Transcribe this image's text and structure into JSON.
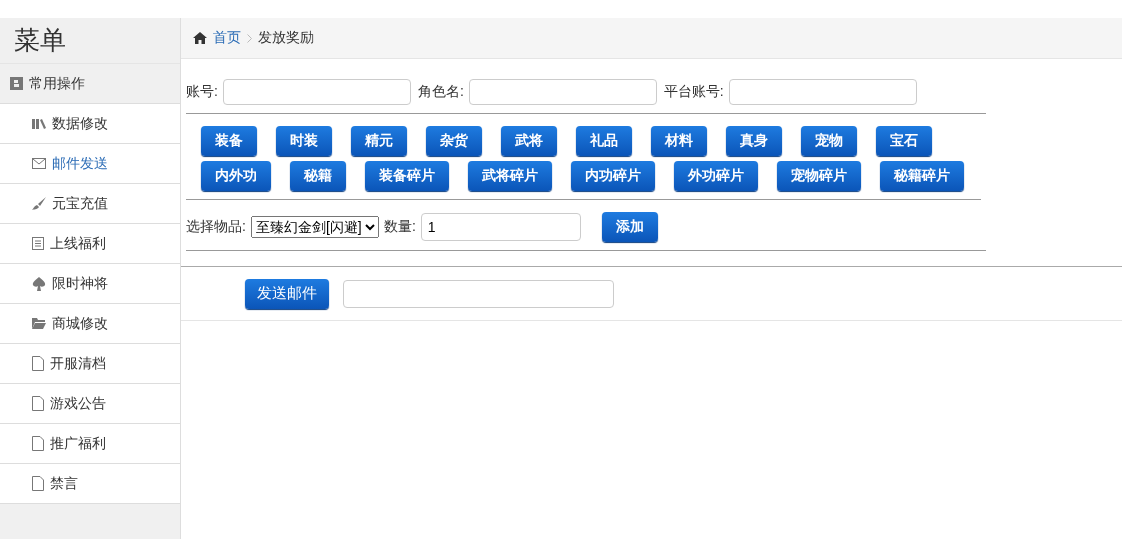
{
  "sidebar": {
    "title": "菜单",
    "section": {
      "label": "常用操作"
    },
    "items": [
      {
        "label": "数据修改",
        "kind": "chart",
        "selected": false
      },
      {
        "label": "邮件发送",
        "kind": "mail",
        "selected": true
      },
      {
        "label": "元宝充值",
        "kind": "brush",
        "selected": false
      },
      {
        "label": "上线福利",
        "kind": "list",
        "selected": false
      },
      {
        "label": "限时神将",
        "kind": "spade",
        "selected": false
      },
      {
        "label": "商城修改",
        "kind": "folder",
        "selected": false
      },
      {
        "label": "开服清档",
        "kind": "file",
        "selected": false
      },
      {
        "label": "游戏公告",
        "kind": "file",
        "selected": false
      },
      {
        "label": "推广福利",
        "kind": "file",
        "selected": false
      },
      {
        "label": "禁言",
        "kind": "file",
        "selected": false
      }
    ]
  },
  "breadcrumb": {
    "home": "首页",
    "current": "发放奖励"
  },
  "fields": [
    {
      "label": "账号:"
    },
    {
      "label": "角色名:"
    },
    {
      "label": "平台账号:"
    }
  ],
  "categories": [
    "装备",
    "时装",
    "精元",
    "杂货",
    "武将",
    "礼品",
    "材料",
    "真身",
    "宠物",
    "宝石",
    "内外功",
    "秘籍",
    "装备碎片",
    "武将碎片",
    "内功碎片",
    "外功碎片",
    "宠物碎片",
    "秘籍碎片"
  ],
  "item_row": {
    "label": "选择物品:",
    "select_value": "至臻幻金剑[闪避]",
    "quantity_label": "数量:",
    "quantity_value": "1",
    "add_button": "添加"
  },
  "send": {
    "button": "发送邮件"
  }
}
